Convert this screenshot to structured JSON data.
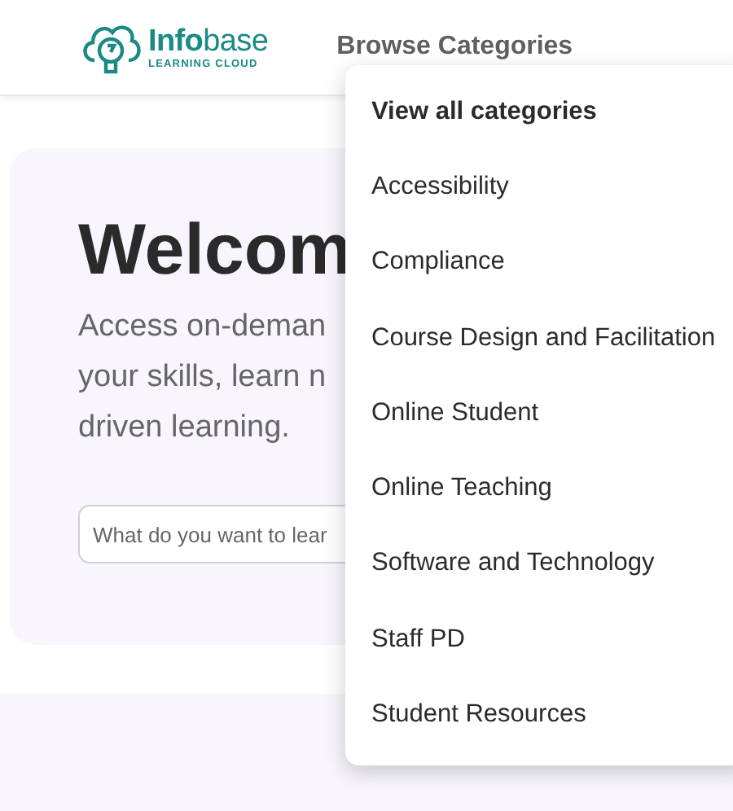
{
  "header": {
    "logo": {
      "name": "**Info**base",
      "tagline": "LEARNING CLOUD"
    },
    "nav": {
      "label": "Browse Categories"
    }
  },
  "hero": {
    "title": "Welcom",
    "lines": [
      "Access on-deman",
      "your skills, learn n",
      "driven learning."
    ],
    "search": {
      "placeholder": "What do you want to lear"
    }
  },
  "menu": [
    {
      "label": "View all categories",
      "kind": "all"
    },
    {
      "label": "Accessibility",
      "kind": "category"
    },
    {
      "label": "Compliance",
      "kind": "category"
    },
    {
      "label": "Course Design and Facilitation",
      "kind": "category"
    },
    {
      "label": "Online Student",
      "kind": "category"
    },
    {
      "label": "Online Teaching",
      "kind": "category"
    },
    {
      "label": "Software and Technology",
      "kind": "category"
    },
    {
      "label": "Staff PD",
      "kind": "category"
    },
    {
      "label": "Student Resources",
      "kind": "category"
    }
  ]
}
